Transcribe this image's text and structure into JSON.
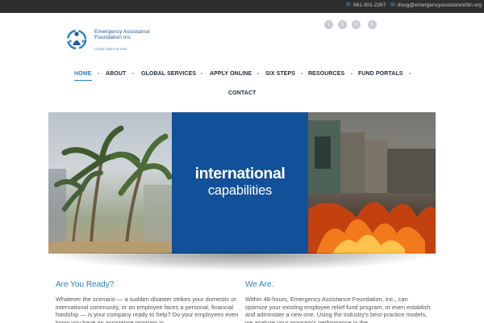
{
  "topbar": {
    "phone": "561-301-2267",
    "email": "doug@emergencyassistancefdn.org"
  },
  "logo": {
    "name": "Emergency Assistance Foundation Inc.",
    "tagline": "charity begins at work"
  },
  "social": [
    {
      "icon": "twitter-icon",
      "glyph": "t"
    },
    {
      "icon": "skype-icon",
      "glyph": "S"
    },
    {
      "icon": "linkedin-icon",
      "glyph": "in"
    },
    {
      "icon": "search-icon",
      "glyph": "⚲"
    }
  ],
  "nav": {
    "items": [
      "HOME",
      "ABOUT",
      "GLOBAL SERVICES",
      "APPLY ONLINE",
      "SIX STEPS",
      "RESOURCES",
      "FUND PORTALS",
      "CONTACT"
    ],
    "active": "HOME"
  },
  "banner": {
    "headline": "international",
    "subheadline": "capabilities"
  },
  "columns": {
    "left": {
      "title": "Are You Ready?",
      "body": "Whatever the scenario — a sudden disaster strikes your domestic or international community, or an employee faces a personal, financial hardship — is your company ready to help? Do your employees even know you have an assistance program in"
    },
    "right": {
      "title": "We Are.",
      "body": "Within 48-hours, Emergency Assistance Foundation, Inc., can optimize your existing employee relief fund program, or even establish and administer a new one. Using the industry's best-practice models, we analyze your program's performance in the"
    }
  },
  "colors": {
    "accent": "#2a7fc4",
    "banner_blue": "#13509a",
    "topbar": "#2e2e2e"
  }
}
